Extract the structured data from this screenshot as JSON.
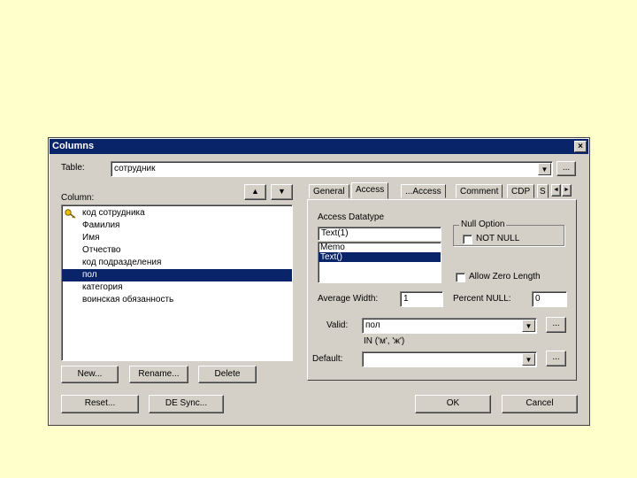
{
  "dialog": {
    "title": "Columns",
    "close_symbol": "×"
  },
  "table": {
    "label": "Table:",
    "value": "сотрудник",
    "browse_label": "..."
  },
  "column": {
    "label": "Column:",
    "items": [
      {
        "text": "код сотрудника",
        "key": true
      },
      {
        "text": "Фамилия"
      },
      {
        "text": "Имя"
      },
      {
        "text": "Отчество"
      },
      {
        "text": "код подразделения"
      },
      {
        "text": "пол",
        "selected": true
      },
      {
        "text": "категория"
      },
      {
        "text": "воинская обязанность"
      }
    ],
    "up_symbol": "▲",
    "down_symbol": "▼"
  },
  "buttons": {
    "new": "New...",
    "rename": "Rename...",
    "delete": "Delete",
    "reset": "Reset...",
    "de_sync": "DE Sync...",
    "ok": "OK",
    "cancel": "Cancel"
  },
  "tabs": [
    "General",
    "Access",
    "...Access",
    "Comment",
    "CDP",
    "S"
  ],
  "access": {
    "datatype_label": "Access Datatype",
    "datatype_value": "Text(1)",
    "datatype_options": [
      "Memo",
      "Text()"
    ],
    "selected_option": "Text()",
    "null_option_label": "Null Option",
    "not_null_label": "NOT NULL",
    "allow_zero_label": "Allow Zero Length",
    "avg_width_label": "Average Width:",
    "avg_width_value": "1",
    "percent_null_label": "Percent NULL:",
    "percent_null_value": "0",
    "valid_label": "Valid:",
    "valid_value": "пол",
    "valid_expr": "IN ('м', 'ж')",
    "default_label": "Default:",
    "default_value": "",
    "browse_label": "..."
  },
  "colors": {
    "background": "#ffffcc",
    "dialog": "#d4d0c8",
    "titlebar": "#0a246a",
    "selection": "#0a246a"
  },
  "icons": {
    "key": "key-icon",
    "dropdown": "dropdown-arrow-icon"
  }
}
